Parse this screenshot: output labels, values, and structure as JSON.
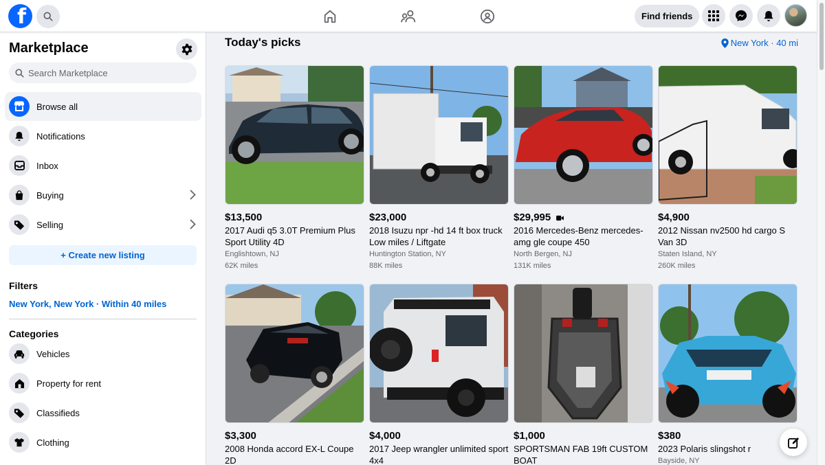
{
  "brand": {
    "logo_letter": "f",
    "accent": "#0866ff",
    "link": "#0064d1"
  },
  "topbar": {
    "icons": [
      "facebook-logo",
      "search-icon",
      "home-icon",
      "friends-icon",
      "groups-icon",
      "menu-grid-icon",
      "messenger-icon",
      "bell-icon"
    ],
    "find_friends": "Find friends"
  },
  "sidebar": {
    "title": "Marketplace",
    "search_placeholder": "Search Marketplace",
    "items": [
      {
        "label": "Browse all",
        "icon": "storefront-icon",
        "active": true
      },
      {
        "label": "Notifications",
        "icon": "bell-icon"
      },
      {
        "label": "Inbox",
        "icon": "inbox-icon"
      },
      {
        "label": "Buying",
        "icon": "shopping-bag-icon",
        "chevron": true
      },
      {
        "label": "Selling",
        "icon": "tag-icon",
        "chevron": true
      }
    ],
    "create_listing": "+ Create new listing",
    "filters_heading": "Filters",
    "filter_location": "New York, New York · Within 40 miles",
    "categories_heading": "Categories",
    "categories": [
      {
        "label": "Vehicles",
        "icon": "car-icon"
      },
      {
        "label": "Property for rent",
        "icon": "house-icon"
      },
      {
        "label": "Classifieds",
        "icon": "tag-icon"
      },
      {
        "label": "Clothing",
        "icon": "shirt-icon"
      }
    ]
  },
  "main": {
    "title": "Today's picks",
    "location": "New York · 40 mi",
    "listings": [
      {
        "price": "$13,500",
        "title": "2017 Audi q5 3.0T Premium Plus Sport Utility 4D",
        "location": "Englishtown, NJ",
        "miles": "62K miles",
        "video": false
      },
      {
        "price": "$23,000",
        "title": "2018 Isuzu npr -hd 14 ft box truck Low miles / Liftgate",
        "location": "Huntington Station, NY",
        "miles": "88K miles",
        "video": false
      },
      {
        "price": "$29,995",
        "title": "2016 Mercedes-Benz mercedes-amg gle coupe 450",
        "location": "North Bergen, NJ",
        "miles": "131K miles",
        "video": true
      },
      {
        "price": "$4,900",
        "title": "2012 Nissan nv2500 hd cargo S Van 3D",
        "location": "Staten Island, NY",
        "miles": "260K miles",
        "video": false
      },
      {
        "price": "$3,300",
        "title": "2008 Honda accord EX-L Coupe 2D",
        "location": "",
        "miles": "",
        "video": false
      },
      {
        "price": "$4,000",
        "title": "2017 Jeep wrangler unlimited sport 4x4",
        "location": "",
        "miles": "",
        "video": false
      },
      {
        "price": "$1,000",
        "title": "SPORTSMAN FAB 19ft CUSTOM BOAT",
        "location": "",
        "miles": "",
        "video": false
      },
      {
        "price": "$380",
        "title": "2023 Polaris slingshot r",
        "location": "Bayside, NY",
        "miles": "",
        "video": false
      }
    ]
  }
}
